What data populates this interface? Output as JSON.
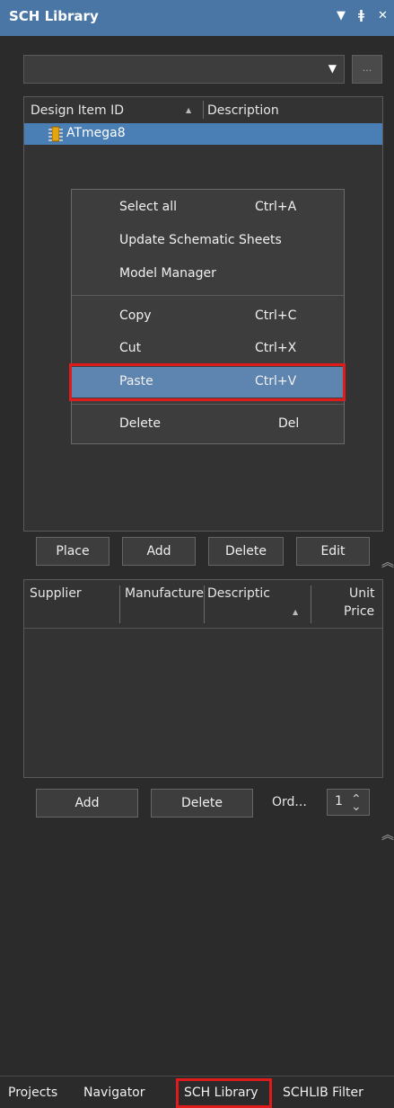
{
  "panel": {
    "title": "SCH Library"
  },
  "list": {
    "columns": [
      "Design Item ID",
      "Description"
    ],
    "items": [
      {
        "id": "ATmega8",
        "description": ""
      }
    ]
  },
  "context_menu": {
    "items": [
      {
        "label": "Select all",
        "shortcut": "Ctrl+A"
      },
      {
        "label": "Update Schematic Sheets",
        "shortcut": ""
      },
      {
        "label": "Model Manager",
        "shortcut": ""
      },
      {
        "label": "Copy",
        "shortcut": "Ctrl+C"
      },
      {
        "label": "Cut",
        "shortcut": "Ctrl+X"
      },
      {
        "label": "Paste",
        "shortcut": "Ctrl+V"
      },
      {
        "label": "Delete",
        "shortcut": "Del"
      }
    ]
  },
  "list_buttons": {
    "place": "Place",
    "add": "Add",
    "delete": "Delete",
    "edit": "Edit"
  },
  "supplier": {
    "columns": [
      "Supplier",
      "Manufacture",
      "Descriptic",
      "Unit",
      "Price"
    ]
  },
  "supplier_buttons": {
    "add": "Add",
    "delete": "Delete",
    "order_label": "Ord...",
    "order_value": "1"
  },
  "browse_label": "...",
  "tabs": [
    "Projects",
    "Navigator",
    "SCH Library",
    "SCHLIB Filter"
  ],
  "colors": {
    "titlebar": "#4a76a6",
    "selected_row": "#4a7fb5",
    "highlight": "#e01b1b"
  }
}
